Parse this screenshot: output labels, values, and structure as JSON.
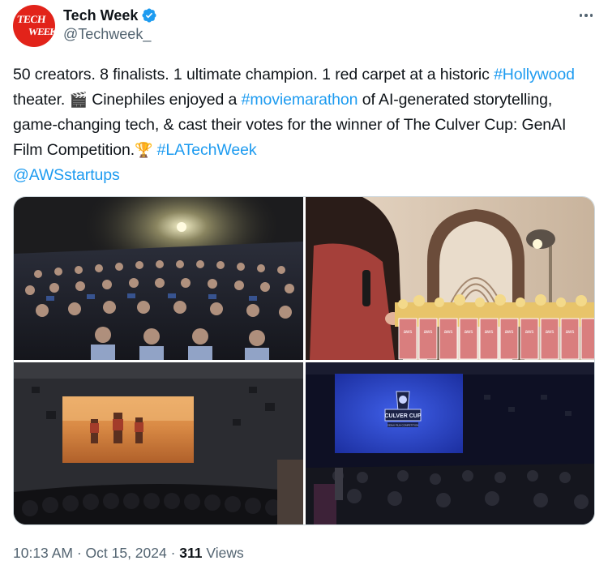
{
  "author": {
    "avatar_text_line1": "TECH",
    "avatar_text_line2": "WEEK",
    "display_name": "Tech Week",
    "handle": "@Techweek_",
    "verified_icon": "verified-badge-icon",
    "verified_color": "#1d9bf0",
    "avatar_color": "#e2231a"
  },
  "tweet": {
    "t1": "50 creators. 8 finalists. 1 ultimate champion. 1 red carpet at a historic ",
    "hashtag_hollywood": "#Hollywood",
    "t2": " theater. ",
    "emoji_clapper": "🎬",
    "t3": " Cinephiles enjoyed a ",
    "hashtag_moviemarathon": "#moviemarathon",
    "t4": " of AI-generated storytelling, game-changing tech, & cast their votes for the winner of The Culver Cup: GenAI Film Competition.",
    "emoji_trophy": "🏆",
    "t5": " ",
    "hashtag_latechweek": "#LATechWeek",
    "mention_awsstartups": "@AWSstartups",
    "link_color": "#1d9bf0"
  },
  "media": {
    "photo_count": 4,
    "photos": [
      {
        "name": "audience-photo",
        "icon": "photo"
      },
      {
        "name": "popcorn-photo",
        "icon": "photo"
      },
      {
        "name": "screening-photo",
        "icon": "photo"
      },
      {
        "name": "culver-cup-screen-photo",
        "icon": "photo"
      }
    ]
  },
  "screen_logo": {
    "line1": "CULVER CUP",
    "line2": "GENAI FILM COMPETITION"
  },
  "popcorn_box_label": "aws",
  "footer": {
    "time": "10:13 AM",
    "separator": " · ",
    "date": "Oct 15, 2024",
    "separator2": " · ",
    "views_count": "311",
    "views_label": " Views"
  }
}
